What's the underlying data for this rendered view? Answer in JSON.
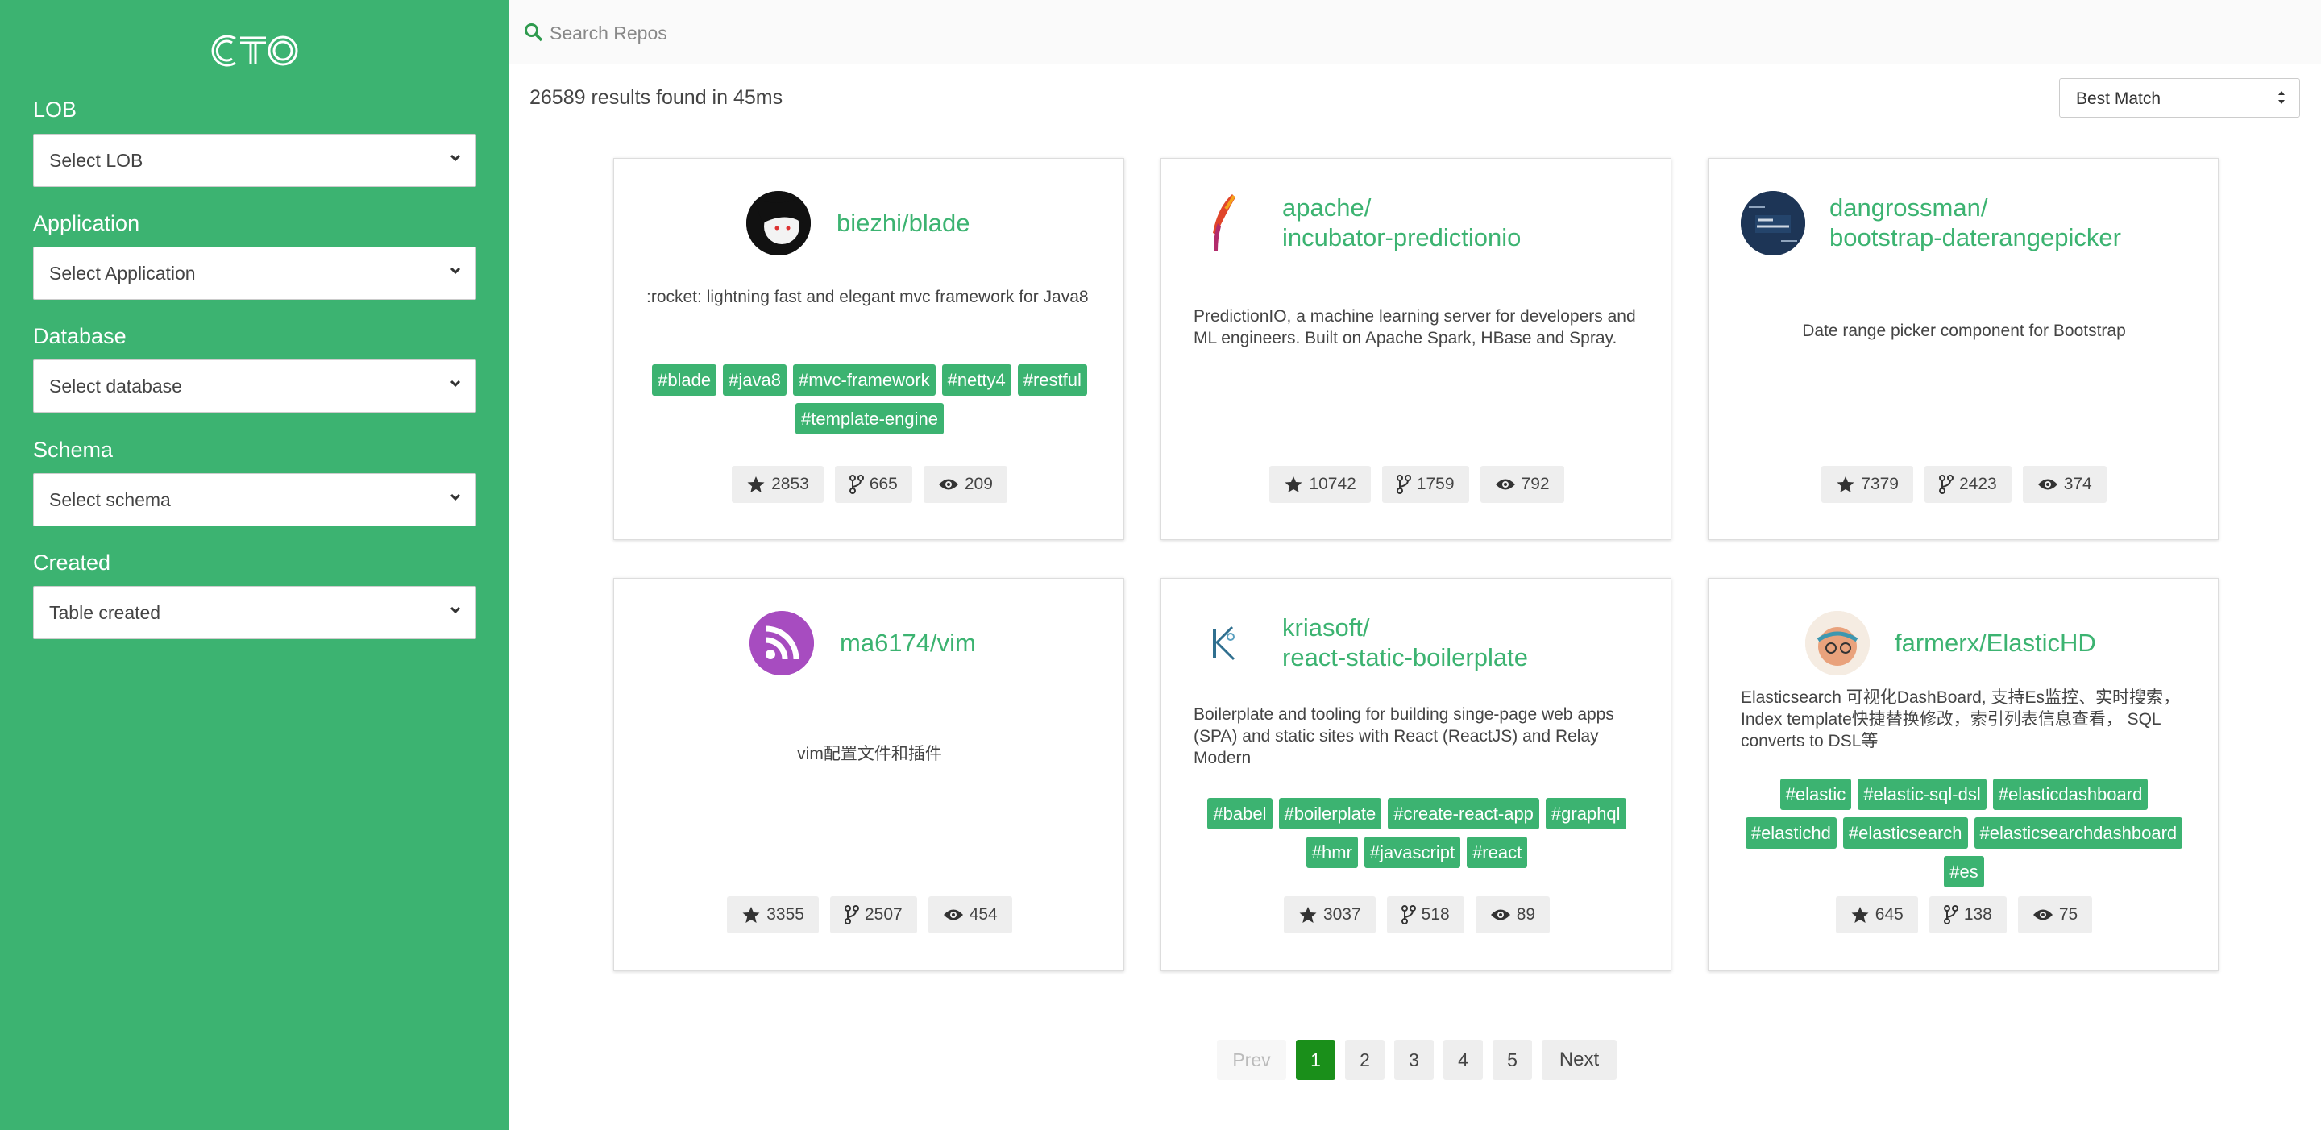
{
  "sidebar": {
    "logo": "CTO",
    "filters": [
      {
        "label": "LOB",
        "value": "Select LOB"
      },
      {
        "label": "Application",
        "value": "Select Application"
      },
      {
        "label": "Database",
        "value": "Select database"
      },
      {
        "label": "Schema",
        "value": "Select schema"
      },
      {
        "label": "Created",
        "value": "Table created"
      }
    ]
  },
  "search": {
    "placeholder": "Search Repos",
    "icon": "search-icon"
  },
  "results_text": "26589 results found in 45ms",
  "sort": {
    "selected": "Best Match"
  },
  "cards": [
    {
      "name": "biezhi/blade",
      "desc": ":rocket: lightning fast and elegant mvc framework for Java8",
      "tags": [
        "#blade",
        "#java8",
        "#mvc-framework",
        "#netty4",
        "#restful",
        "#template-engine"
      ],
      "stars": "2853",
      "forks": "665",
      "watchers": "209"
    },
    {
      "name_line1": "apache/",
      "name_line2": "incubator-predictionio",
      "desc": "PredictionIO, a machine learning server for developers and ML engineers. Built on Apache Spark, HBase and Spray.",
      "tags": [],
      "stars": "10742",
      "forks": "1759",
      "watchers": "792"
    },
    {
      "name_line1": "dangrossman/",
      "name_line2": "bootstrap-daterangepicker",
      "desc": "Date range picker component for Bootstrap",
      "tags": [],
      "stars": "7379",
      "forks": "2423",
      "watchers": "374"
    },
    {
      "name": "ma6174/vim",
      "desc": "vim配置文件和插件",
      "tags": [],
      "stars": "3355",
      "forks": "2507",
      "watchers": "454"
    },
    {
      "name_line1": "kriasoft/",
      "name_line2": "react-static-boilerplate",
      "desc": "Boilerplate and tooling for building singe-page web apps (SPA) and static sites with React (ReactJS) and Relay Modern",
      "tags": [
        "#babel",
        "#boilerplate",
        "#create-react-app",
        "#graphql",
        "#hmr",
        "#javascript",
        "#react"
      ],
      "stars": "3037",
      "forks": "518",
      "watchers": "89"
    },
    {
      "name": "farmerx/ElasticHD",
      "desc": "Elasticsearch 可视化DashBoard, 支持Es监控、实时搜索， Index template快捷替换修改，索引列表信息查看， SQL converts to DSL等",
      "tags": [
        "#elastic",
        "#elastic-sql-dsl",
        "#elasticdashboard",
        "#elastichd",
        "#elasticsearch",
        "#elasticsearchdashboard",
        "#es"
      ],
      "stars": "645",
      "forks": "138",
      "watchers": "75"
    }
  ],
  "pagination": {
    "prev": "Prev",
    "pages": [
      "1",
      "2",
      "3",
      "4",
      "5"
    ],
    "active": "1",
    "next": "Next"
  },
  "colors": {
    "accent": "#3cb371",
    "active_page": "#1a8f1a"
  }
}
